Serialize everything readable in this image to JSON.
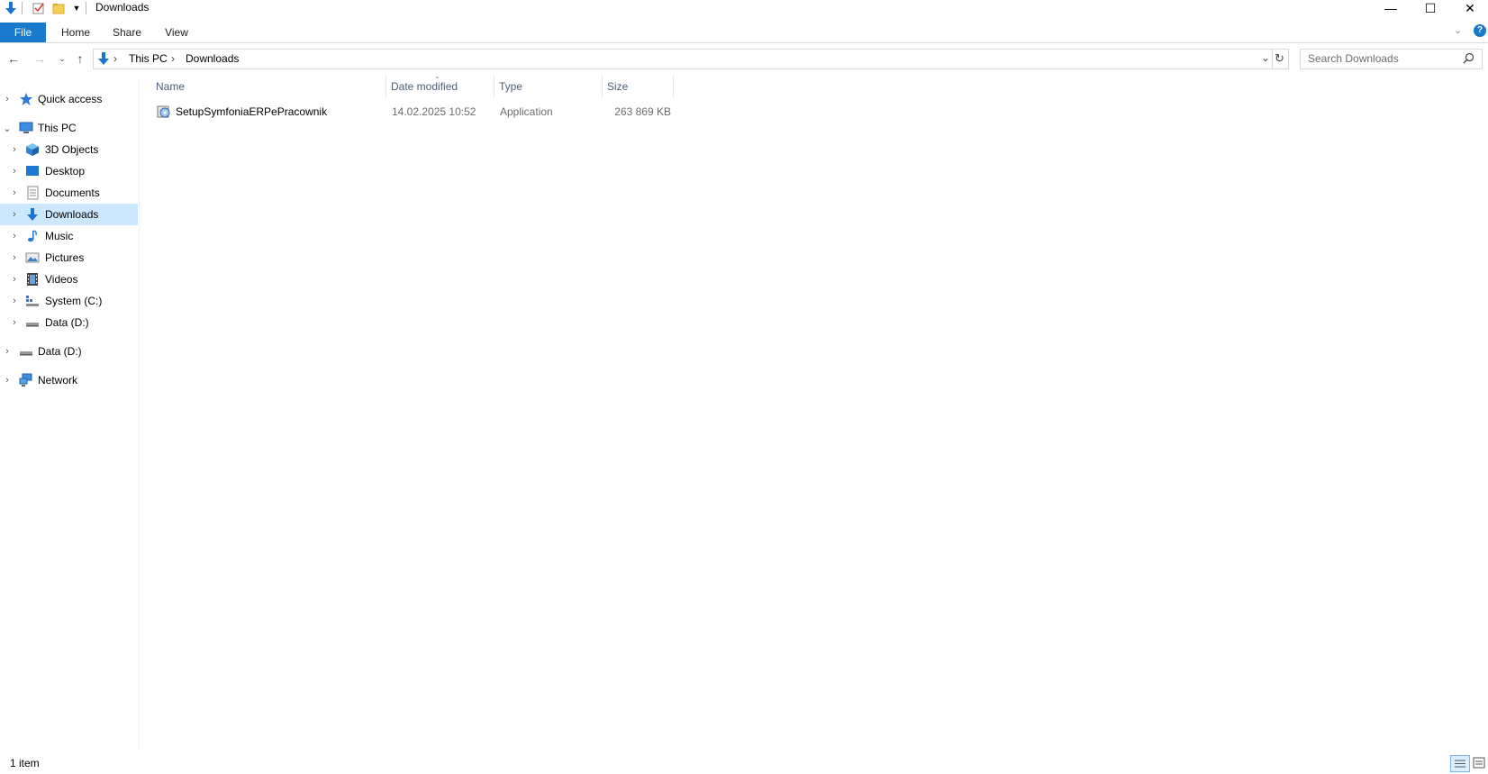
{
  "window": {
    "title": "Downloads",
    "minimize_glyph": "—",
    "maximize_glyph": "☐",
    "close_glyph": "✕"
  },
  "ribbon": {
    "tabs": [
      "File",
      "Home",
      "Share",
      "View"
    ],
    "accent_color": "#1979ca"
  },
  "address": {
    "crumbs": [
      "This PC",
      "Downloads"
    ],
    "separator": "›"
  },
  "search": {
    "placeholder": "Search Downloads"
  },
  "sidebar": {
    "items": [
      {
        "label": "Quick access",
        "icon": "star-icon"
      },
      {
        "label": "This PC",
        "icon": "computer-icon"
      },
      {
        "label": "3D Objects",
        "icon": "cube-icon"
      },
      {
        "label": "Desktop",
        "icon": "desktop-icon"
      },
      {
        "label": "Documents",
        "icon": "document-icon"
      },
      {
        "label": "Downloads",
        "icon": "download-icon",
        "selected": true
      },
      {
        "label": "Music",
        "icon": "music-note-icon"
      },
      {
        "label": "Pictures",
        "icon": "picture-icon"
      },
      {
        "label": "Videos",
        "icon": "film-icon"
      },
      {
        "label": "System (C:)",
        "icon": "system-drive-icon"
      },
      {
        "label": "Data (D:)",
        "icon": "drive-icon"
      },
      {
        "label": "Data (D:)",
        "icon": "drive-icon"
      },
      {
        "label": "Network",
        "icon": "network-icon"
      }
    ],
    "selected_color": "#cce8ff"
  },
  "columns": [
    "Name",
    "Date modified",
    "Type",
    "Size"
  ],
  "files": [
    {
      "name": "SetupSymfoniaERPePracownik",
      "date": "14.02.2025 10:52",
      "type": "Application",
      "size": "263 869 KB",
      "icon": "installer-icon"
    }
  ],
  "status": {
    "item_count": "1 item"
  }
}
